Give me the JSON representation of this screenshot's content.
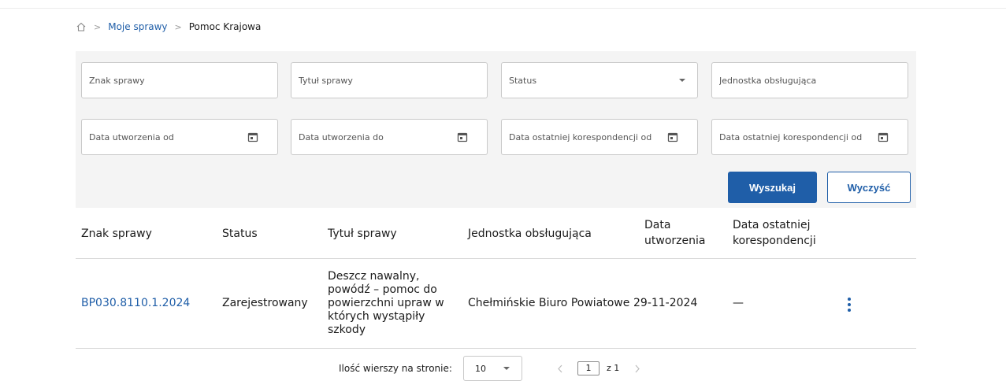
{
  "breadcrumb": {
    "items": [
      "Moje sprawy",
      "Pomoc Krajowa"
    ]
  },
  "filters": {
    "znak_sprawy": "Znak sprawy",
    "tytul_sprawy": "Tytuł sprawy",
    "status": "Status",
    "jednostka": "Jednostka obsługująca",
    "data_utworzenia_od": "Data utworzenia od",
    "data_utworzenia_do": "Data utworzenia do",
    "data_korespondencji_od": "Data ostatniej korespondencji od",
    "data_korespondencji_od_2": "Data ostatniej korespondencji od"
  },
  "buttons": {
    "search": "Wyszukaj",
    "clear": "Wyczyść"
  },
  "table": {
    "headers": {
      "znak": "Znak sprawy",
      "status": "Status",
      "tytul": "Tytuł sprawy",
      "jednostka": "Jednostka obsługująca",
      "data_utworzenia_1": "Data",
      "data_utworzenia_2": "utworzenia",
      "data_koresp_1": "Data ostatniej",
      "data_koresp_2": "korespondencji"
    },
    "rows": [
      {
        "znak": "BP030.8110.1.2024",
        "status": "Zarejestrowany",
        "tytul_lines": [
          "Deszcz nawalny,",
          "powódź – pomoc do",
          "powierzchni upraw w",
          "których wystąpiły",
          "szkody"
        ],
        "jednostka": "Chełmińskie Biuro Powiatowe",
        "data_utworzenia": "29-11-2024",
        "data_korespondencji": "—"
      }
    ]
  },
  "pagination": {
    "rows_label": "Ilość wierszy na stronie:",
    "rows_value": "10",
    "current_page": "1",
    "total_label": "z 1"
  },
  "colors": {
    "accent": "#1f5ea8",
    "panel": "#f4f4f4"
  },
  "icons": [
    "home-icon",
    "chevron-right-icon",
    "calendar-icon",
    "chevron-down-icon",
    "kebab-menu-icon",
    "chevron-left-icon"
  ]
}
